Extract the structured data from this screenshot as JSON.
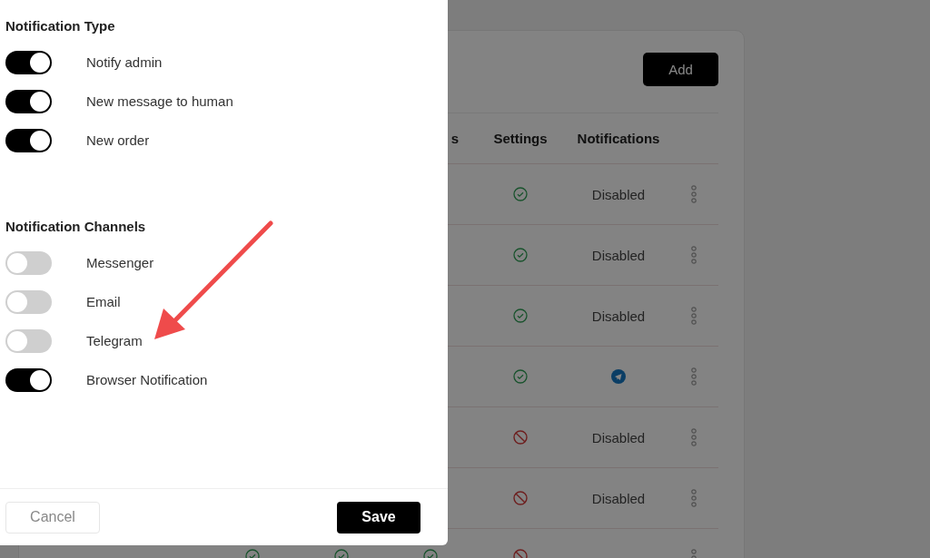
{
  "page": {
    "add_button": "Add",
    "table": {
      "columns": [
        {
          "label": "s"
        },
        {
          "label": "Settings"
        },
        {
          "label": "Notifications"
        }
      ],
      "rows": [
        {
          "settings_ok": true,
          "notifications": {
            "kind": "text",
            "text": "Disabled"
          }
        },
        {
          "settings_ok": true,
          "notifications": {
            "kind": "text",
            "text": "Disabled"
          }
        },
        {
          "settings_ok": true,
          "notifications": {
            "kind": "text",
            "text": "Disabled"
          }
        },
        {
          "settings_ok": true,
          "notifications": {
            "kind": "telegram"
          }
        },
        {
          "settings_ok": false,
          "notifications": {
            "kind": "text",
            "text": "Disabled"
          }
        },
        {
          "settings_ok": false,
          "notifications": {
            "kind": "text",
            "text": "Disabled"
          }
        },
        {
          "flags": [
            true,
            true,
            true
          ],
          "settings_ok": false
        }
      ]
    }
  },
  "panel": {
    "sections": [
      {
        "title": "Notification Type",
        "items": [
          {
            "label": "Notify admin",
            "on": true
          },
          {
            "label": "New message to human",
            "on": true
          },
          {
            "label": "New order",
            "on": true
          }
        ]
      },
      {
        "title": "Notification Channels",
        "items": [
          {
            "label": "Messenger",
            "on": false
          },
          {
            "label": "Email",
            "on": false
          },
          {
            "label": "Telegram",
            "on": false
          },
          {
            "label": "Browser Notification",
            "on": true
          }
        ]
      }
    ],
    "cancel_button": "Cancel",
    "save_button": "Save"
  }
}
